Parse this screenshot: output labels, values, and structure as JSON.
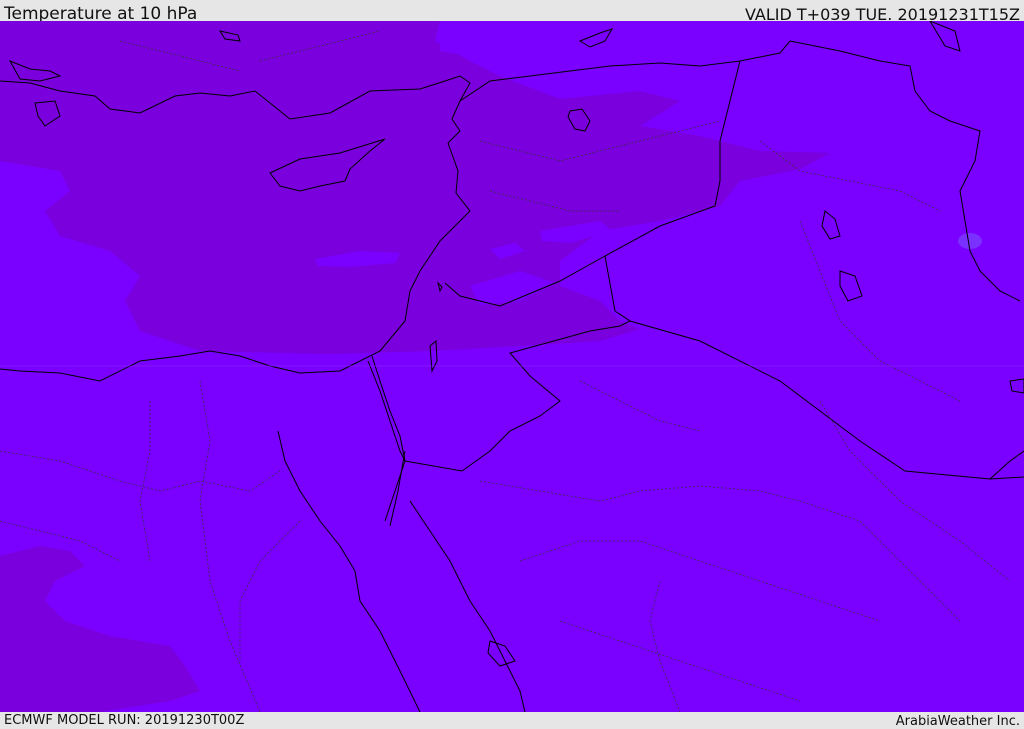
{
  "header": {
    "title": "Temperature at 10 hPa",
    "valid_time": "VALID T+039 TUE. 20191231T15Z"
  },
  "footer": {
    "model_run": "ECMWF MODEL RUN: 20191230T00Z",
    "credit": "ArabiaWeather Inc."
  },
  "map": {
    "colors": {
      "base_field": "#7a00ff",
      "cold_field": "#7a00dd",
      "light_patch": "#8010ff",
      "coastline": "#000000",
      "border": "#000000",
      "province_border": "#333333"
    }
  }
}
